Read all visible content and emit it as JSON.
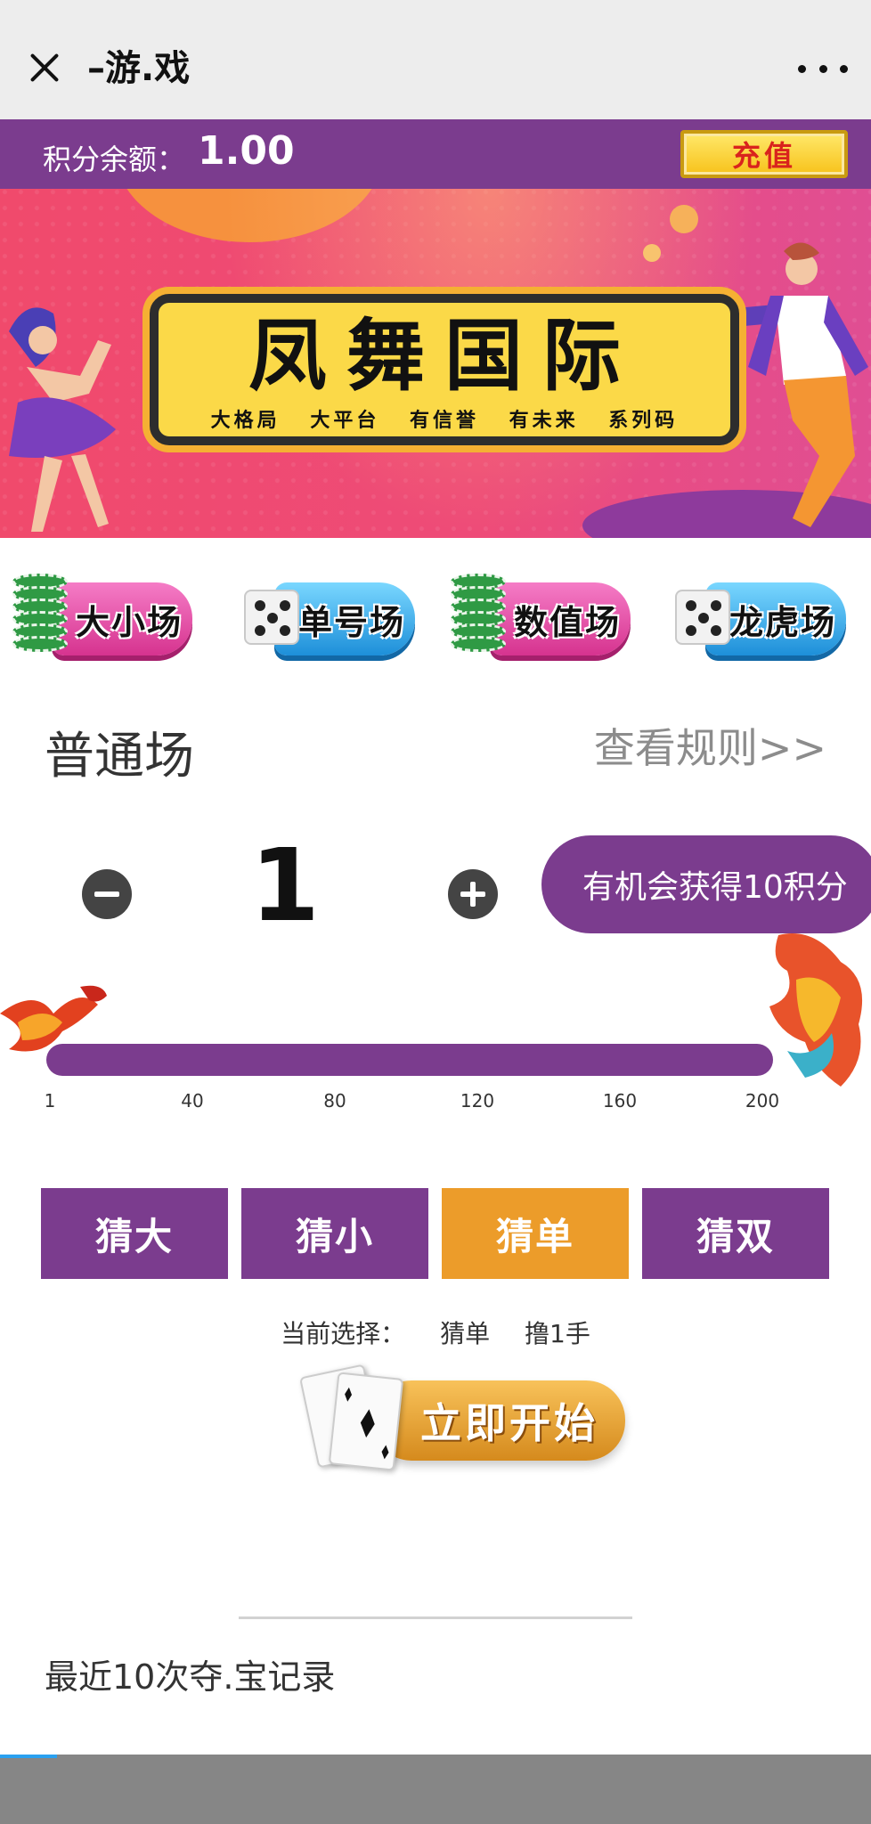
{
  "header": {
    "title": "–游.戏",
    "close_icon": "close-icon",
    "more_icon": "more-horizontal-icon"
  },
  "balance": {
    "label": "积分余额：",
    "value": "1.00",
    "recharge_label": "充值"
  },
  "banner": {
    "title": "凤舞国际",
    "subtitle": "大格局 大平台 有信誉 有未来 系列码"
  },
  "mode_tabs": [
    {
      "label": "大小场",
      "icon": "chips-icon"
    },
    {
      "label": "单号场",
      "icon": "dice-icon"
    },
    {
      "label": "数值场",
      "icon": "chips-icon"
    },
    {
      "label": "龙虎场",
      "icon": "dice-icon"
    }
  ],
  "section": {
    "title": "普通场",
    "rules_link": "查看规则>>"
  },
  "stepper": {
    "value": "1",
    "chance_text": "有机会获得10积分"
  },
  "slider": {
    "min": 1,
    "max": 200,
    "value": 1,
    "ticks": [
      "1",
      "40",
      "80",
      "120",
      "160",
      "200"
    ]
  },
  "guess_options": [
    {
      "label": "猜大",
      "selected": false
    },
    {
      "label": "猜小",
      "selected": false
    },
    {
      "label": "猜单",
      "selected": true
    },
    {
      "label": "猜双",
      "selected": false
    }
  ],
  "current_choice": {
    "label": "当前选择：",
    "choice": "猜单",
    "amount": "撸1手"
  },
  "start_button": {
    "label": "立即开始"
  },
  "history": {
    "title": "最近10次夺.宝记录"
  },
  "colors": {
    "primary_purple": "#7b3c8e",
    "selected_orange": "#ec9c2a",
    "recharge_red": "#d9231d"
  }
}
